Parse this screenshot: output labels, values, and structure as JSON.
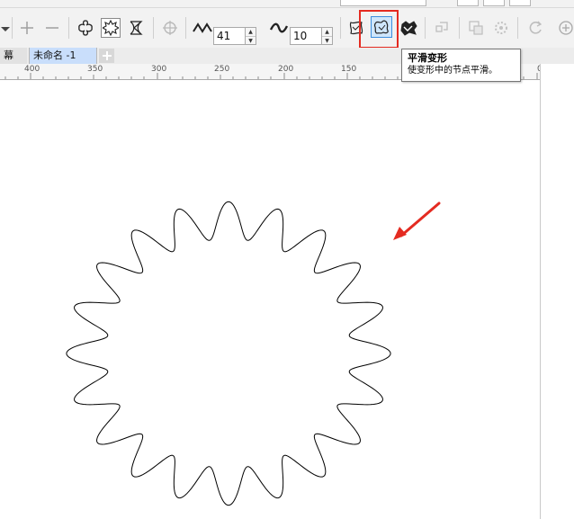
{
  "property_bar": {
    "amplitude_value": "41",
    "frequency_value": "10"
  },
  "tabs": [
    {
      "label": "幕"
    },
    {
      "label": "未命名 -1"
    }
  ],
  "ruler": {
    "labels": [
      "400",
      "350",
      "300",
      "250",
      "200",
      "150",
      "0"
    ]
  },
  "tooltip": {
    "title": "平滑变形",
    "description": "使变形中的节点平滑。"
  },
  "icons": [
    "dropdown-arrow-icon",
    "add-node-icon",
    "remove-node-icon",
    "push-pull-distortion-icon",
    "zipper-distortion-icon",
    "twister-distortion-icon",
    "center-distortion-icon",
    "amplitude-icon",
    "frequency-icon",
    "random-distortion-icon",
    "smooth-distortion-icon",
    "local-distortion-icon",
    "copy-distortion-icon",
    "clear-distortion-icon",
    "convert-to-curves-icon",
    "refresh-icon",
    "add-tab-icon",
    "annotation-arrow-icon",
    "zigzag-star-shape"
  ],
  "colors": {
    "highlight_box": "#e42b21",
    "annotation_arrow": "#e42b21",
    "active_button": "#cfe6fb",
    "shape_outline": "#000000"
  }
}
